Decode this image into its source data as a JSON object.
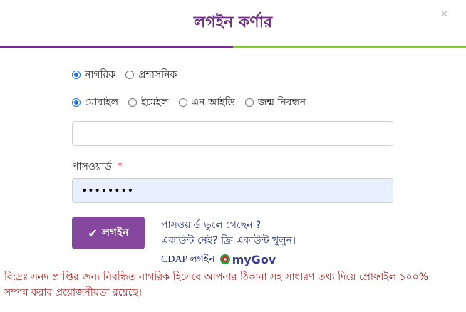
{
  "dialog": {
    "title": "লগইন কর্ণার",
    "close_label": "×"
  },
  "user_type": {
    "options": [
      {
        "label": "নাগরিক",
        "selected": true
      },
      {
        "label": "প্রশাসনিক",
        "selected": false
      }
    ]
  },
  "login_method": {
    "options": [
      {
        "label": "মোবাইল",
        "selected": true
      },
      {
        "label": "ইমেইল",
        "selected": false
      },
      {
        "label": "এন আইডি",
        "selected": false
      },
      {
        "label": "জন্ম নিবন্ধন",
        "selected": false
      }
    ]
  },
  "identifier_field": {
    "value": "",
    "placeholder": ""
  },
  "password_field": {
    "label": "পাসওয়ার্ড",
    "required_mark": "*",
    "value": "••••••••"
  },
  "login_button": {
    "label": "লগইন",
    "icon": "check-icon"
  },
  "links": {
    "forgot_password": "পাসওয়ার্ড ভুলে গেছেন ?",
    "create_account": "একাউন্ট নেই? ফ্রি একাউন্ট খুলুন।"
  },
  "cdap": {
    "label": "CDAP লগইন",
    "logo_text": "myGov"
  },
  "notice": "বি:দ্রঃ সনদ প্রাপ্তির জন্য নিবন্ধিত নাগরিক হিসেবে আপনার ঠিকানা সহ সাধারণ তথ্য দিয়ে প্রোফাইল ১০০% সম্পন্ন করার প্রয়োজনীয়তা রয়েছে।",
  "colors": {
    "brand_purple": "#6f2f86",
    "accent_green": "#8cc44a",
    "button_purple": "#86479f",
    "notice_red": "#9c1b1b",
    "link_blue": "#1e2f73"
  }
}
